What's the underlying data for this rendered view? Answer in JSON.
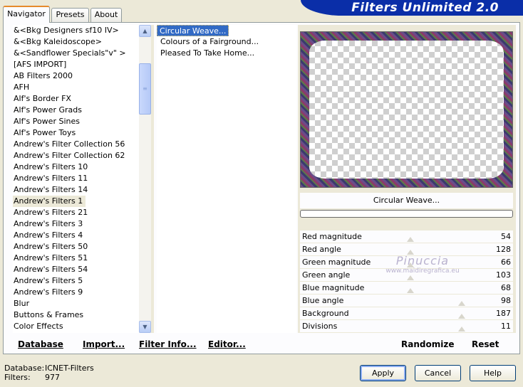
{
  "banner": {
    "title": "Filters Unlimited 2.0"
  },
  "tabs": [
    {
      "label": "Navigator",
      "active": true
    },
    {
      "label": "Presets",
      "active": false
    },
    {
      "label": "About",
      "active": false
    }
  ],
  "categories": {
    "items": [
      "&<Bkg Designers sf10 IV>",
      "&<Bkg Kaleidoscope>",
      "&<Sandflower Specials\"v\" >",
      "[AFS IMPORT]",
      "AB Filters 2000",
      "AFH",
      "Alf's Border FX",
      "Alf's Power Grads",
      "Alf's Power Sines",
      "Alf's Power Toys",
      "Andrew's Filter Collection 56",
      "Andrew's Filter Collection 62",
      "Andrew's Filters 10",
      "Andrew's Filters 11",
      "Andrew's Filters 14",
      "Andrew's Filters 1",
      "Andrew's Filters 21",
      "Andrew's Filters 3",
      "Andrew's Filters 4",
      "Andrew's Filters 50",
      "Andrew's Filters 51",
      "Andrew's Filters 54",
      "Andrew's Filters 5",
      "Andrew's Filters 9",
      "Blur",
      "Buttons & Frames",
      "Color Effects"
    ],
    "selected": "Andrew's Filters 1"
  },
  "filters": {
    "items": [
      "Circular Weave...",
      "Colours of a Fairground...",
      "Pleased To Take Home..."
    ],
    "selected": "Circular Weave..."
  },
  "preview": {
    "filter_name": "Circular Weave..."
  },
  "parameters": [
    {
      "name": "Red magnitude",
      "value": "54"
    },
    {
      "name": "Red angle",
      "value": "128"
    },
    {
      "name": "Green magnitude",
      "value": "66"
    },
    {
      "name": "Green angle",
      "value": "103"
    },
    {
      "name": "Blue magnitude",
      "value": "68"
    },
    {
      "name": "Blue angle",
      "value": "98"
    },
    {
      "name": "Background",
      "value": "187"
    },
    {
      "name": "Divisions",
      "value": "11"
    }
  ],
  "watermark": {
    "name": "Pinuccia",
    "url": "www.maidiregrafica.eu"
  },
  "bottom_bar": {
    "database": "Database",
    "import": "Import...",
    "filter_info": "Filter Info...",
    "editor": "Editor...",
    "randomize": "Randomize",
    "reset": "Reset"
  },
  "status": {
    "database_label": "Database:",
    "database_value": "ICNET-Filters",
    "filters_label": "Filters:",
    "filters_value": "977"
  },
  "buttons": {
    "apply": "Apply",
    "cancel": "Cancel",
    "help": "Help"
  }
}
